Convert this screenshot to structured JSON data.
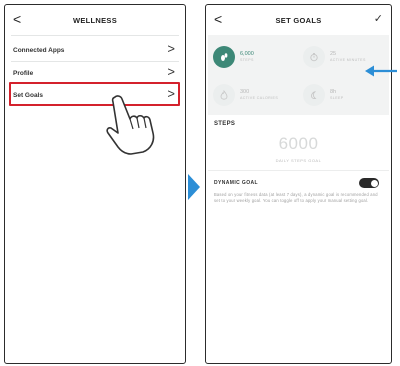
{
  "left_screen": {
    "title": "WELLNESS",
    "back_glyph": "<",
    "menu": [
      {
        "label": "Connected Apps",
        "chevron": ">"
      },
      {
        "label": "Profile",
        "chevron": ">"
      },
      {
        "label": "Set Goals",
        "chevron": ">"
      }
    ],
    "highlighted_item": "Set Goals"
  },
  "right_screen": {
    "title": "SET GOALS",
    "back_glyph": "<",
    "confirm_glyph": "✓",
    "goals": [
      {
        "value": "6,000",
        "label": "STEPS",
        "icon": "steps-icon",
        "active": true
      },
      {
        "value": "25",
        "label": "ACTIVE MINUTES",
        "icon": "stopwatch-icon",
        "active": false
      },
      {
        "value": "300",
        "label": "ACTIVE CALORIES",
        "icon": "flame-icon",
        "active": false
      },
      {
        "value": "8h",
        "label": "SLEEP",
        "icon": "moon-icon",
        "active": false
      }
    ],
    "steps": {
      "heading": "STEPS",
      "value": "6000",
      "caption": "DAILY STEPS GOAL"
    },
    "dynamic_goal": {
      "heading": "DYNAMIC GOAL",
      "enabled": true,
      "description": "Based on your fitness data (at least 7 days), a dynamic goal is recommended and set to your weekly goal. You can toggle off to apply your manual setting goal."
    }
  },
  "colors": {
    "highlight_border": "#d4212c",
    "accent_green": "#3d8877",
    "arrow_blue": "#2c8ed6",
    "toggle_on": "#2a2a2a"
  },
  "icons": {
    "transition_arrow": "triangle-right-icon",
    "pointer": "hand-pointer-icon",
    "callout_arrow": "arrow-left-icon"
  }
}
